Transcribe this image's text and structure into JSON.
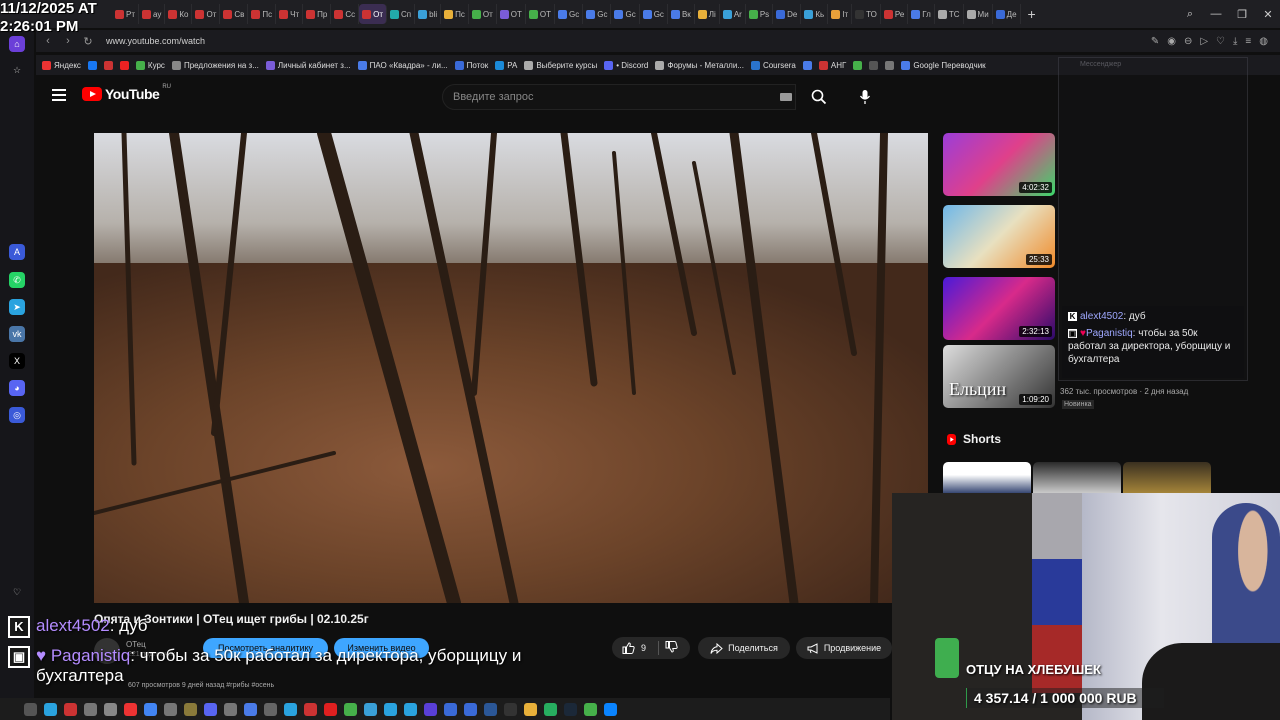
{
  "overlay": {
    "clock_line1": "11/12/2025 AT",
    "clock_line2": "2:26:01 PM"
  },
  "browser": {
    "tabs": [
      {
        "label": "Рт",
        "color": "#c33"
      },
      {
        "label": "ау",
        "color": "#c33"
      },
      {
        "label": "Ко",
        "color": "#c33"
      },
      {
        "label": "От",
        "color": "#c33"
      },
      {
        "label": "Св",
        "color": "#c33"
      },
      {
        "label": "Пс",
        "color": "#c33"
      },
      {
        "label": "Чт",
        "color": "#c33"
      },
      {
        "label": "Пр",
        "color": "#c33"
      },
      {
        "label": "Сс",
        "color": "#c33"
      },
      {
        "label": "От",
        "color": "#c33",
        "active": true
      },
      {
        "label": "Сп",
        "color": "#2aa"
      },
      {
        "label": "bli",
        "color": "#3aa0d8"
      },
      {
        "label": "Пс",
        "color": "#e8b03a"
      },
      {
        "label": "От",
        "color": "#46b04a"
      },
      {
        "label": "ОТ",
        "color": "#7a5cd8"
      },
      {
        "label": "ОТ",
        "color": "#46b04a"
      },
      {
        "label": "Gc",
        "color": "#4a7be8"
      },
      {
        "label": "Gc",
        "color": "#4a7be8"
      },
      {
        "label": "Gc",
        "color": "#4a7be8"
      },
      {
        "label": "Gc",
        "color": "#4a7be8"
      },
      {
        "label": "Вк",
        "color": "#4a7be8"
      },
      {
        "label": "Лі",
        "color": "#e8b03a"
      },
      {
        "label": "Ar",
        "color": "#3aa0d8"
      },
      {
        "label": "Ps",
        "color": "#46b04a"
      },
      {
        "label": "De",
        "color": "#3a6ad8"
      },
      {
        "label": "Кь",
        "color": "#3aa0d8"
      },
      {
        "label": "Іт",
        "color": "#e8a03a"
      },
      {
        "label": "ТО",
        "color": "#333"
      },
      {
        "label": "Ре",
        "color": "#c33"
      },
      {
        "label": "Гл",
        "color": "#4a7be8"
      },
      {
        "label": "ТС",
        "color": "#aaa"
      },
      {
        "label": "Ми",
        "color": "#aaa"
      },
      {
        "label": "Де",
        "color": "#3a6ad8"
      }
    ],
    "url": "www.youtube.com/watch",
    "bookmarks": [
      {
        "label": "Яндекс",
        "color": "#e33"
      },
      {
        "label": "",
        "color": "#1877f2"
      },
      {
        "label": "",
        "color": "#c33"
      },
      {
        "label": "",
        "color": "#e22"
      },
      {
        "label": "Курс",
        "color": "#46b04a"
      },
      {
        "label": "Предложения на з...",
        "color": "#888"
      },
      {
        "label": "Личный кабинет з...",
        "color": "#7a5cd8"
      },
      {
        "label": "ПАО «Квадра» - ли...",
        "color": "#4a7be8"
      },
      {
        "label": "Поток",
        "color": "#3a6ad8"
      },
      {
        "label": "РА",
        "color": "#1b8ad8"
      },
      {
        "label": "Выберите курсы",
        "color": "#aaa"
      },
      {
        "label": "• Discord",
        "color": "#5865f2"
      },
      {
        "label": "Форумы - Металли...",
        "color": "#aaa"
      },
      {
        "label": "Coursera",
        "color": "#2a73cc"
      },
      {
        "label": "",
        "color": "#4a7be8"
      },
      {
        "label": "АНГ",
        "color": "#c33"
      },
      {
        "label": "",
        "color": "#46b04a"
      },
      {
        "label": "",
        "color": "#555"
      },
      {
        "label": "",
        "color": "#777"
      },
      {
        "label": "Google Переводчик",
        "color": "#4a7be8"
      }
    ]
  },
  "youtube": {
    "logo_text": "YouTube",
    "logo_region": "RU",
    "search_placeholder": "Введите запрос",
    "video_title": "Опята и Зонтики | ОТец ищет грибы | 02.10.25г",
    "channel_name": "ОТец",
    "subscribers": "221 подписчик",
    "analytics_label": "Посмотреть аналитику",
    "edit_label": "Изменить видео",
    "likes": "9",
    "share_label": "Поделиться",
    "promote_label": "Продвижение",
    "views_date": "607 просмотров  9 дней назад  #грибы #осень",
    "recommendations": [
      {
        "duration": "4:02:32",
        "colors": [
          "#9b3dd8",
          "#e0408a",
          "#3bd86a"
        ]
      },
      {
        "duration": "25:33",
        "colors": [
          "#6fb7e8",
          "#e8e0c0",
          "#f08a2a"
        ]
      },
      {
        "duration": "2:32:13",
        "colors": [
          "#4a1ad8",
          "#d82a8a",
          "#2a0a6a"
        ]
      },
      {
        "duration": "1:09:20",
        "colors": [
          "#ddd",
          "#888",
          "#333"
        ],
        "text": "Ельцин"
      }
    ],
    "rec_views": "362 тыс. просмотров · 2 дня назад",
    "rec_badge": "Новинка",
    "shorts_label": "Shorts"
  },
  "chat_window": {
    "title": "Мессенджер",
    "messages": [
      {
        "user": "alext4502",
        "text": ": дуб"
      },
      {
        "user": "Paganistiq",
        "text": ": чтобы за 50к работал за директора, уборщицу и бухгалтера"
      }
    ]
  },
  "stream_chat": {
    "messages": [
      {
        "badge": "K",
        "user": "alext4502",
        "text": ": дуб"
      },
      {
        "badge": "▣",
        "user": "♥ Paganistiq",
        "text": ": чтобы за 50к работал за директора, уборщицу и бухгалтера"
      }
    ]
  },
  "goal": {
    "title": "ОТЦУ НА ХЛЕБУШЕК",
    "amount": "4 357.14 / 1 000 000 RUB",
    "progress": 0.0044
  },
  "colors": {
    "accent": "#3ea6ff",
    "brand_red": "#ff0000",
    "chat_username": "#b48cff"
  }
}
